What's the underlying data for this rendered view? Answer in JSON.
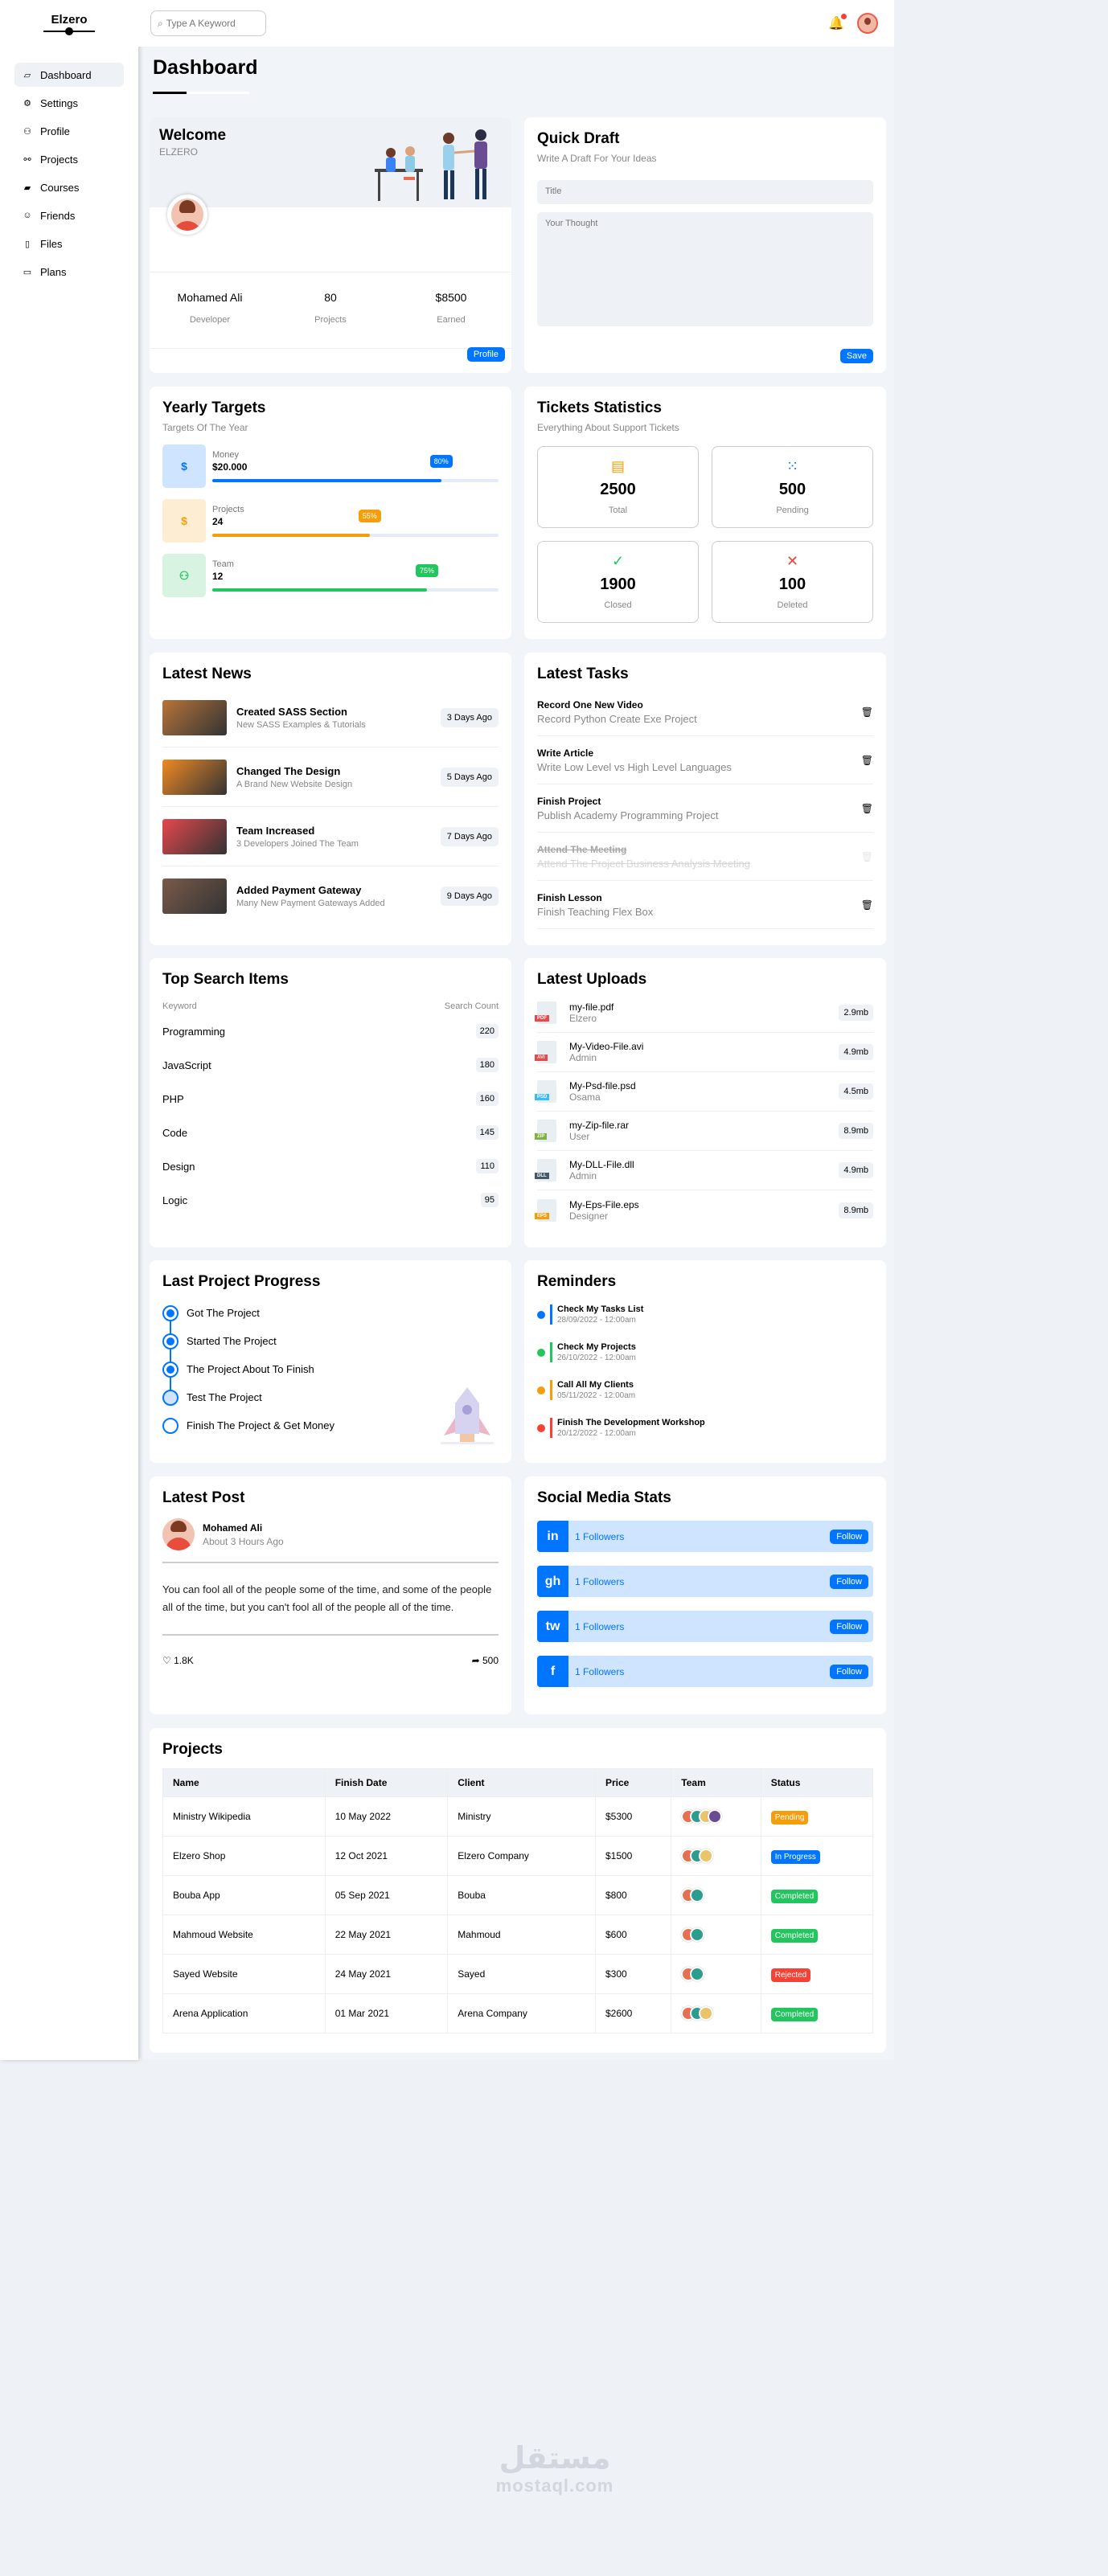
{
  "sidebar": {
    "logo": "Elzero",
    "items": [
      {
        "label": "Dashboard",
        "icon": "chart-icon"
      },
      {
        "label": "Settings",
        "icon": "gear-icon"
      },
      {
        "label": "Profile",
        "icon": "user-icon"
      },
      {
        "label": "Projects",
        "icon": "diagram-icon"
      },
      {
        "label": "Courses",
        "icon": "graduation-icon"
      },
      {
        "label": "Friends",
        "icon": "circle-user-icon"
      },
      {
        "label": "Files",
        "icon": "file-icon"
      },
      {
        "label": "Plans",
        "icon": "credit-card-icon"
      }
    ]
  },
  "topbar": {
    "search_placeholder": "Type A Keyword"
  },
  "page": {
    "title": "Dashboard"
  },
  "welcome": {
    "title": "Welcome",
    "subtitle": "ELZERO",
    "stats": [
      {
        "value": "Mohamed Ali",
        "label": "Developer"
      },
      {
        "value": "80",
        "label": "Projects"
      },
      {
        "value": "$8500",
        "label": "Earned"
      }
    ],
    "button": "Profile"
  },
  "draft": {
    "title": "Quick Draft",
    "subtitle": "Write A Draft For Your Ideas",
    "title_placeholder": "Title",
    "body_placeholder": "Your Thought",
    "button": "Save"
  },
  "targets": {
    "title": "Yearly Targets",
    "subtitle": "Targets Of The Year",
    "items": [
      {
        "label": "Money",
        "value": "$20.000",
        "progress": 80,
        "tag": "80%",
        "color": "#0075ff",
        "bg": "#cfe4ff",
        "icon": "$"
      },
      {
        "label": "Projects",
        "value": "24",
        "progress": 55,
        "tag": "55%",
        "color": "#f59e0b",
        "bg": "#fdeed3",
        "icon": "$"
      },
      {
        "label": "Team",
        "value": "12",
        "progress": 75,
        "tag": "75%",
        "color": "#22c55e",
        "bg": "#d8f3e1",
        "icon": "user"
      }
    ]
  },
  "tickets": {
    "title": "Tickets Statistics",
    "subtitle": "Everything About Support Tickets",
    "items": [
      {
        "num": "2500",
        "label": "Total",
        "color": "#f59e0b",
        "icon": "▤"
      },
      {
        "num": "500",
        "label": "Pending",
        "color": "#0075ff",
        "icon": "⁙"
      },
      {
        "num": "1900",
        "label": "Closed",
        "color": "#22c55e",
        "icon": "✓"
      },
      {
        "num": "100",
        "label": "Deleted",
        "color": "#f44336",
        "icon": "✕"
      }
    ]
  },
  "news": {
    "title": "Latest News",
    "items": [
      {
        "title": "Created SASS Section",
        "desc": "New SASS Examples & Tutorials",
        "ago": "3 Days Ago",
        "color": "#b8743a"
      },
      {
        "title": "Changed The Design",
        "desc": "A Brand New Website Design",
        "ago": "5 Days Ago",
        "color": "#f08a24"
      },
      {
        "title": "Team Increased",
        "desc": "3 Developers Joined The Team",
        "ago": "7 Days Ago",
        "color": "#e5484d"
      },
      {
        "title": "Added Payment Gateway",
        "desc": "Many New Payment Gateways Added",
        "ago": "9 Days Ago",
        "color": "#7a5a4a"
      }
    ]
  },
  "tasks": {
    "title": "Latest Tasks",
    "items": [
      {
        "title": "Record One New Video",
        "desc": "Record Python Create Exe Project",
        "done": false
      },
      {
        "title": "Write Article",
        "desc": "Write Low Level vs High Level Languages",
        "done": false
      },
      {
        "title": "Finish Project",
        "desc": "Publish Academy Programming Project",
        "done": false
      },
      {
        "title": "Attend The Meeting",
        "desc": "Attend The Project Business Analysis Meeting",
        "done": true
      },
      {
        "title": "Finish Lesson",
        "desc": "Finish Teaching Flex Box",
        "done": false
      }
    ]
  },
  "search_items": {
    "title": "Top Search Items",
    "col_keyword": "Keyword",
    "col_count": "Search Count",
    "rows": [
      {
        "k": "Programming",
        "c": "220"
      },
      {
        "k": "JavaScript",
        "c": "180"
      },
      {
        "k": "PHP",
        "c": "160"
      },
      {
        "k": "Code",
        "c": "145"
      },
      {
        "k": "Design",
        "c": "110"
      },
      {
        "k": "Logic",
        "c": "95"
      }
    ]
  },
  "uploads": {
    "title": "Latest Uploads",
    "items": [
      {
        "name": "my-file.pdf",
        "user": "Elzero",
        "size": "2.9mb",
        "ext": "PDF",
        "color": "#e5484d"
      },
      {
        "name": "My-Video-File.avi",
        "user": "Admin",
        "size": "4.9mb",
        "ext": "AVI",
        "color": "#e5484d"
      },
      {
        "name": "My-Psd-file.psd",
        "user": "Osama",
        "size": "4.5mb",
        "ext": "PSD",
        "color": "#38bdf8"
      },
      {
        "name": "my-Zip-file.rar",
        "user": "User",
        "size": "8.9mb",
        "ext": "ZIP",
        "color": "#7cb342"
      },
      {
        "name": "My-DLL-File.dll",
        "user": "Admin",
        "size": "4.9mb",
        "ext": "DLL",
        "color": "#455a64"
      },
      {
        "name": "My-Eps-File.eps",
        "user": "Designer",
        "size": "8.9mb",
        "ext": "EPS",
        "color": "#f59e0b"
      }
    ]
  },
  "progress": {
    "title": "Last Project Progress",
    "steps": [
      {
        "label": "Got The Project",
        "state": "done"
      },
      {
        "label": "Started The Project",
        "state": "done"
      },
      {
        "label": "The Project About To Finish",
        "state": "done"
      },
      {
        "label": "Test The Project",
        "state": "current"
      },
      {
        "label": "Finish The Project & Get Money",
        "state": "todo"
      }
    ]
  },
  "reminders": {
    "title": "Reminders",
    "items": [
      {
        "title": "Check My Tasks List",
        "date": "28/09/2022 - 12:00am",
        "color": "#0075ff"
      },
      {
        "title": "Check My Projects",
        "date": "26/10/2022 - 12:00am",
        "color": "#22c55e"
      },
      {
        "title": "Call All My Clients",
        "date": "05/11/2022 - 12:00am",
        "color": "#f59e0b"
      },
      {
        "title": "Finish The Development Workshop",
        "date": "20/12/2022 - 12:00am",
        "color": "#f44336"
      }
    ]
  },
  "post": {
    "title": "Latest Post",
    "author": "Mohamed Ali",
    "time": "About 3 Hours Ago",
    "body": "You can fool all of the people some of the time, and some of the people all of the time, but you can't fool all of the people all of the time.",
    "likes": "1.8K",
    "shares": "500"
  },
  "social": {
    "title": "Social Media Stats",
    "items": [
      {
        "icon": "in",
        "text": "1 Followers",
        "button": "Follow",
        "name": "linkedin-icon"
      },
      {
        "icon": "gh",
        "text": "1 Followers",
        "button": "Follow",
        "name": "github-icon"
      },
      {
        "icon": "tw",
        "text": "1 Followers",
        "button": "Follow",
        "name": "twitter-icon"
      },
      {
        "icon": "f",
        "text": "1 Followers",
        "button": "Follow",
        "name": "facebook-icon"
      }
    ]
  },
  "projects": {
    "title": "Projects",
    "headers": [
      "Name",
      "Finish Date",
      "Client",
      "Price",
      "Team",
      "Status"
    ],
    "rows": [
      {
        "name": "Ministry Wikipedia",
        "date": "10 May 2022",
        "client": "Ministry",
        "price": "$5300",
        "team": 4,
        "status": "Pending",
        "color": "#f59e0b"
      },
      {
        "name": "Elzero Shop",
        "date": "12 Oct 2021",
        "client": "Elzero Company",
        "price": "$1500",
        "team": 3,
        "status": "In Progress",
        "color": "#0075ff"
      },
      {
        "name": "Bouba App",
        "date": "05 Sep 2021",
        "client": "Bouba",
        "price": "$800",
        "team": 2,
        "status": "Completed",
        "color": "#22c55e"
      },
      {
        "name": "Mahmoud Website",
        "date": "22 May 2021",
        "client": "Mahmoud",
        "price": "$600",
        "team": 2,
        "status": "Completed",
        "color": "#22c55e"
      },
      {
        "name": "Sayed Website",
        "date": "24 May 2021",
        "client": "Sayed",
        "price": "$300",
        "team": 2,
        "status": "Rejected",
        "color": "#f44336"
      },
      {
        "name": "Arena Application",
        "date": "01 Mar 2021",
        "client": "Arena Company",
        "price": "$2600",
        "team": 3,
        "status": "Completed",
        "color": "#22c55e"
      }
    ]
  },
  "watermark": {
    "arabic": "مستقل",
    "latin": "mostaql.com"
  }
}
